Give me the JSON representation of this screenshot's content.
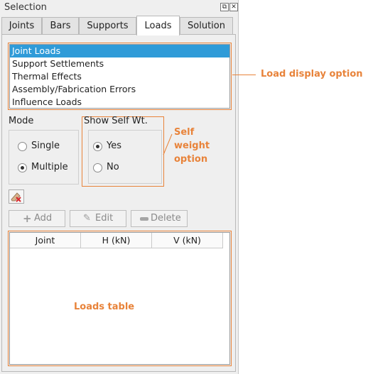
{
  "window": {
    "title": "Selection"
  },
  "tabs": [
    {
      "label": "Joints"
    },
    {
      "label": "Bars"
    },
    {
      "label": "Supports"
    },
    {
      "label": "Loads"
    },
    {
      "label": "Solution"
    }
  ],
  "active_tab": "Loads",
  "load_list": {
    "items": [
      {
        "label": "Joint Loads",
        "selected": true
      },
      {
        "label": "Support Settlements"
      },
      {
        "label": "Thermal Effects"
      },
      {
        "label": "Assembly/Fabrication Errors"
      },
      {
        "label": "Influence Loads"
      }
    ]
  },
  "mode": {
    "label": "Mode",
    "options": [
      {
        "label": "Single"
      },
      {
        "label": "Multiple"
      }
    ],
    "selected": "Multiple"
  },
  "self_weight": {
    "label": "Show Self Wt.",
    "options": [
      {
        "label": "Yes"
      },
      {
        "label": "No"
      }
    ],
    "selected": "Yes"
  },
  "buttons": {
    "add": "Add",
    "edit": "Edit",
    "delete": "Delete"
  },
  "table": {
    "columns": [
      "Joint",
      "H (kN)",
      "V (kN)"
    ],
    "rows": []
  },
  "annotations": {
    "load_display": "Load display option",
    "self_weight": [
      "Self",
      "weight",
      "option"
    ],
    "loads_table": "Loads table"
  },
  "colors": {
    "accent": "#e8833a",
    "selection": "#2f9bd8"
  }
}
